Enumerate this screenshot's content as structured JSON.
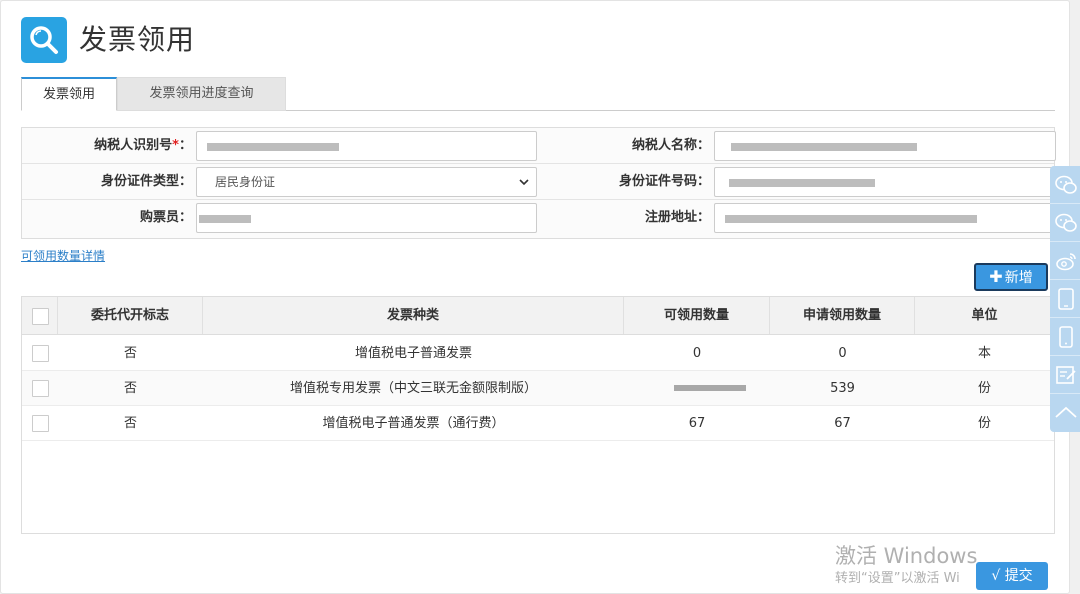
{
  "page": {
    "title": "发票领用",
    "title_icon": "search-icon"
  },
  "tabs": [
    {
      "label": "发票领用",
      "active": true
    },
    {
      "label": "发票领用进度查询",
      "active": false
    }
  ],
  "form": {
    "taxpayer_id_label": "纳税人识别号",
    "required_mark": "*",
    "colon": "：",
    "taxpayer_name_label": "纳税人名称：",
    "id_type_label": "身份证件类型：",
    "id_type_value": "居民身份证",
    "id_number_label": "身份证件号码：",
    "buyer_label": "购票员：",
    "address_label": "注册地址："
  },
  "links": {
    "available_detail": "可领用数量详情"
  },
  "buttons": {
    "add_plus": "✚",
    "add_label": "新增",
    "submit_check": "√",
    "submit_label": "提交"
  },
  "table": {
    "columns": [
      "委托代开标志",
      "发票种类",
      "可领用数量",
      "申请领用数量",
      "单位"
    ],
    "rows": [
      {
        "delegated": "否",
        "type": "增值税电子普通发票",
        "available": "0",
        "requested": "0",
        "unit": "本"
      },
      {
        "delegated": "否",
        "type": "增值税专用发票（中文三联无金额限制版）",
        "available": "",
        "requested": "539",
        "unit": "份"
      },
      {
        "delegated": "否",
        "type": "增值税电子普通发票（通行费）",
        "available": "67",
        "requested": "67",
        "unit": "份"
      }
    ]
  },
  "watermark": {
    "line1": "激活 Windows",
    "line2": "转到“设置”以激活 Wi"
  },
  "sidebar": {
    "icons": [
      "wechat-icon",
      "wechat-icon",
      "weibo-icon",
      "tablet-icon",
      "phone-icon",
      "edit-icon",
      "chevron-up-icon"
    ]
  },
  "colors": {
    "accent": "#29a3e2",
    "button": "#3a97e0",
    "required": "#e02020",
    "link": "#2c7fc8"
  }
}
